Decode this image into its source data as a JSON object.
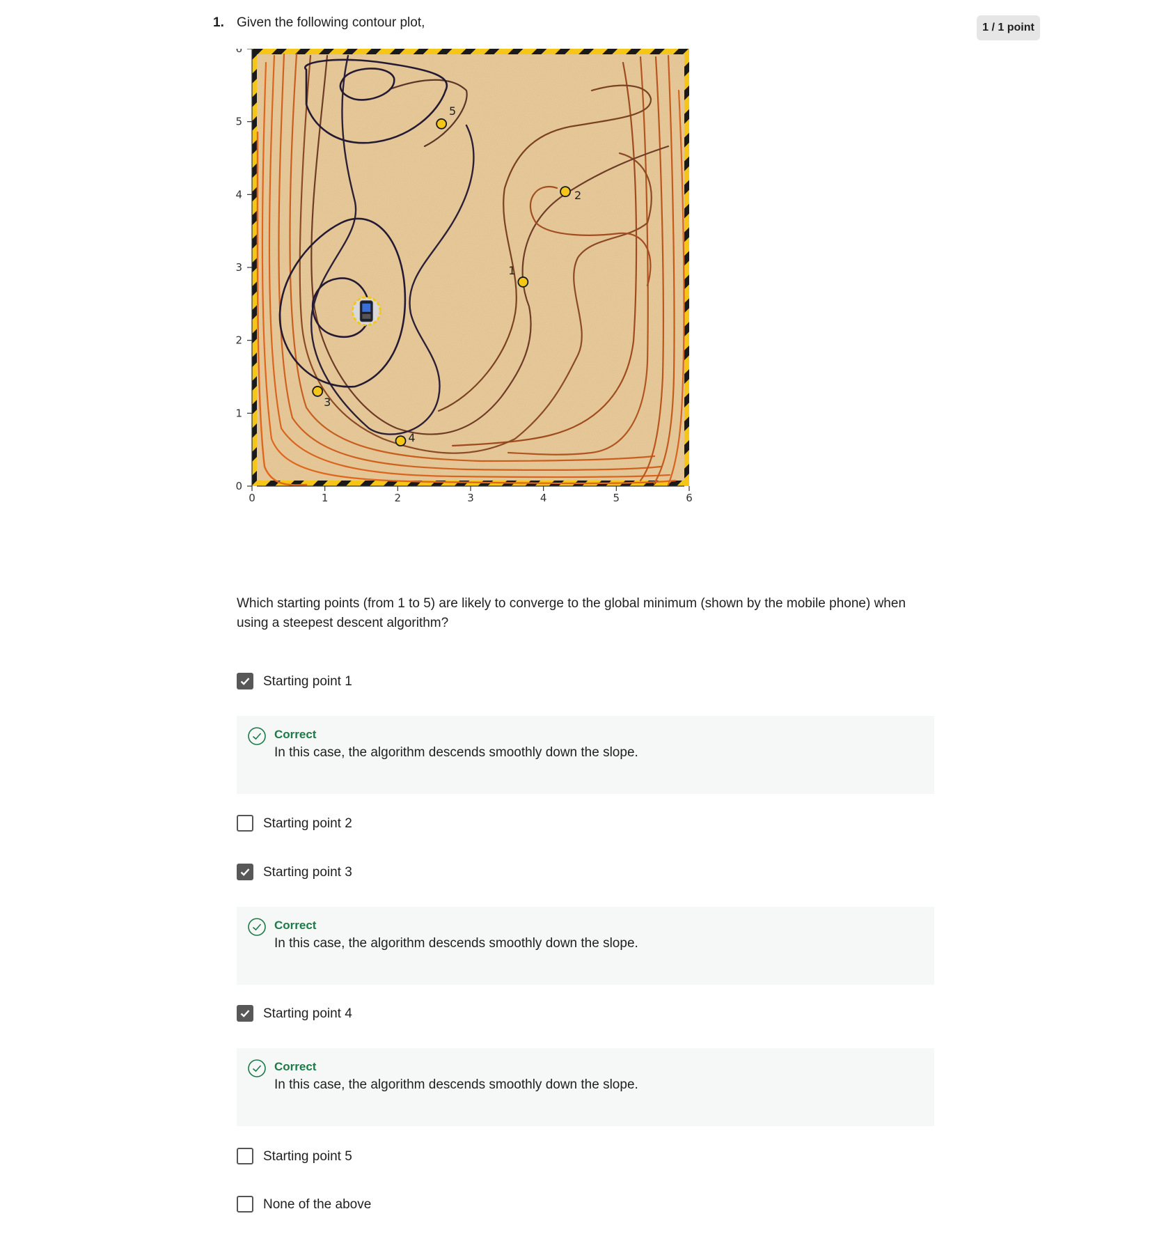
{
  "question": {
    "number": "1.",
    "prompt": "Given the following contour plot,",
    "score": "1 / 1 point",
    "text": "Which starting points (from 1 to 5) are likely to converge to the global minimum (shown by the mobile phone) when using a steepest descent algorithm?"
  },
  "plot": {
    "x_ticks": [
      "0",
      "1",
      "2",
      "3",
      "4",
      "5",
      "6"
    ],
    "y_ticks": [
      "0",
      "1",
      "2",
      "3",
      "4",
      "5",
      "6"
    ],
    "points": [
      {
        "label": "1",
        "x": 3.72,
        "y": 2.8
      },
      {
        "label": "2",
        "x": 4.3,
        "y": 4.04
      },
      {
        "label": "3",
        "x": 0.9,
        "y": 1.3
      },
      {
        "label": "4",
        "x": 2.04,
        "y": 0.62
      },
      {
        "label": "5",
        "x": 2.6,
        "y": 4.97
      }
    ],
    "minimum": {
      "x": 1.57,
      "y": 2.4,
      "icon": "mobile-phone-icon"
    },
    "colors": {
      "background": "#e8c793",
      "hazard_yellow": "#f5c518",
      "dark_contour": "#241a33",
      "orange_contour": "#e0661c"
    }
  },
  "options": [
    {
      "label": "Starting point 1",
      "checked": true
    },
    {
      "label": "Starting point 2",
      "checked": false
    },
    {
      "label": "Starting point 3",
      "checked": true
    },
    {
      "label": "Starting point 4",
      "checked": true
    },
    {
      "label": "Starting point 5",
      "checked": false
    },
    {
      "label": "None of the above",
      "checked": false
    }
  ],
  "feedback": [
    {
      "title": "Correct",
      "text": "In this case, the algorithm descends smoothly down the slope."
    },
    {
      "title": "Correct",
      "text": "In this case, the algorithm descends smoothly down the slope."
    },
    {
      "title": "Correct",
      "text": "In this case, the algorithm descends smoothly down the slope."
    }
  ]
}
